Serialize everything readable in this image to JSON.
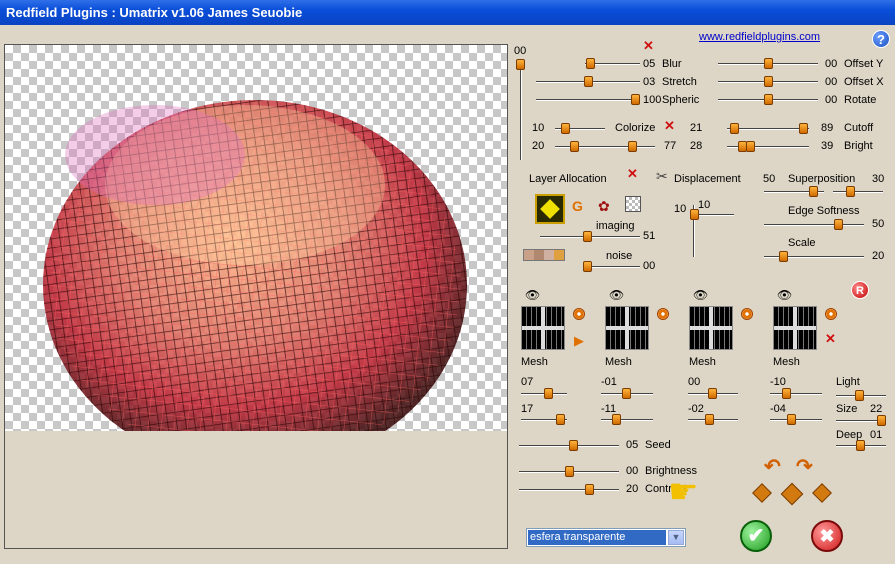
{
  "window": {
    "title": "Redfield Plugins : Umatrix v1.06   James Seuobie"
  },
  "link": "www.redfieldplugins.com",
  "top_sliders": {
    "vertical_value": "00",
    "blur": {
      "label": "Blur",
      "value": "05"
    },
    "stretch": {
      "label": "Stretch",
      "value": "03"
    },
    "spheric": {
      "label": "Spheric",
      "value": "100"
    },
    "offset_y": {
      "label": "Offset Y",
      "value": "00"
    },
    "offset_x": {
      "label": "Offset X",
      "value": "00"
    },
    "rotate": {
      "label": "Rotate",
      "value": "00"
    }
  },
  "colorize": {
    "label": "Colorize",
    "left_top": "10",
    "left_bottom": "20",
    "right_bottom": "77"
  },
  "cutoff": {
    "label": "Cutoff",
    "left_top": "21",
    "right_top": "89",
    "left_bottom": "28"
  },
  "bright": {
    "label": "Bright",
    "value": "39"
  },
  "layer_allocation": {
    "label": "Layer Allocation",
    "imaging_label": "imaging",
    "imaging_value": "51",
    "noise_label": "noise",
    "noise_value": "00"
  },
  "displacement": {
    "label": "Displacement",
    "value_left": "10",
    "value_right": "10"
  },
  "superposition": {
    "label": "Superposition",
    "value_left": "50",
    "value_right": "30"
  },
  "edge_softness": {
    "label": "Edge Softness",
    "value": "50"
  },
  "scale": {
    "label": "Scale",
    "value": "20"
  },
  "mesh": {
    "labels": [
      "Mesh",
      "Mesh",
      "Mesh",
      "Mesh"
    ]
  },
  "mesh_values": {
    "row1": [
      "07",
      "-01",
      "00",
      "-10"
    ],
    "row2": [
      "17",
      "-11",
      "-02",
      "-04"
    ]
  },
  "light": {
    "label": "Light"
  },
  "size": {
    "label": "Size",
    "value": "22"
  },
  "deep": {
    "label": "Deep",
    "value": "01"
  },
  "seed": {
    "label": "Seed",
    "value": "05"
  },
  "brightness": {
    "label": "Brightness",
    "value": "00"
  },
  "contrast": {
    "label": "Contrast",
    "value": "20"
  },
  "preset": {
    "selected": "esfera transparente"
  },
  "buttons": {
    "ok": "✔",
    "cancel": "✖",
    "reset": "R",
    "help": "?"
  }
}
